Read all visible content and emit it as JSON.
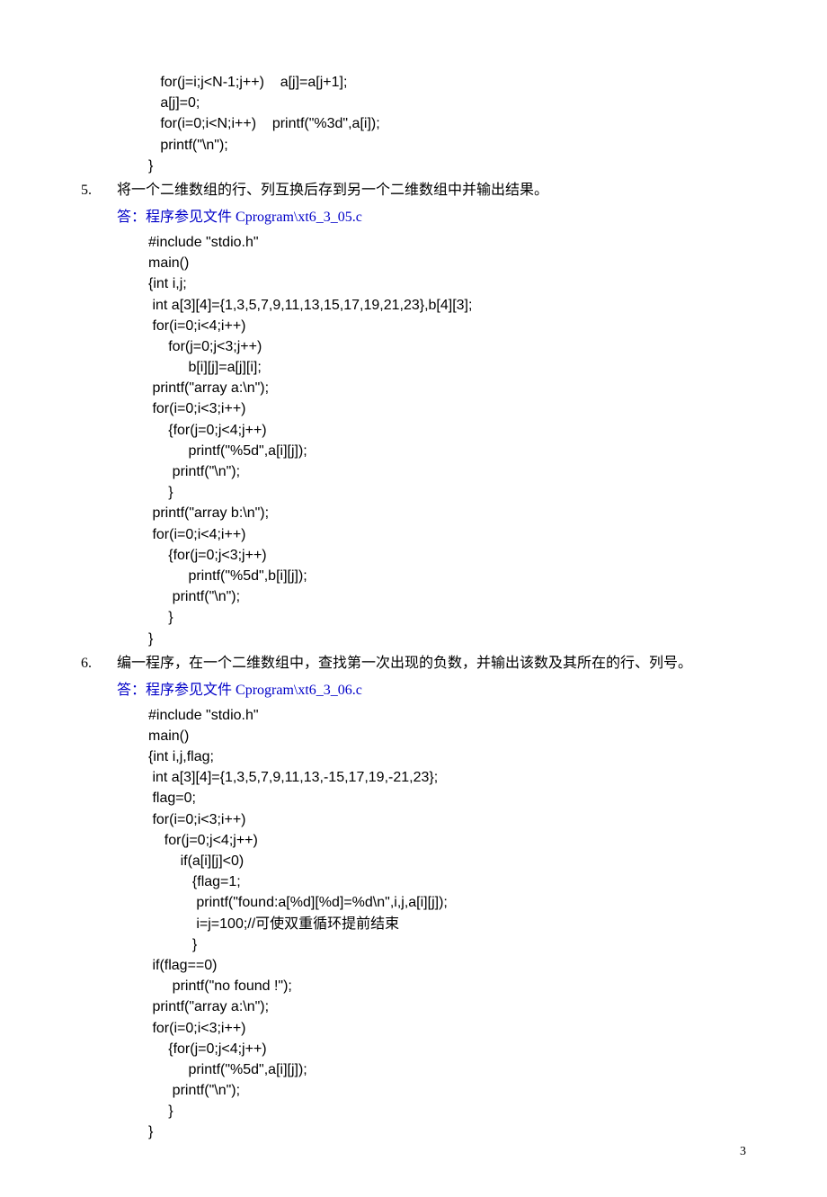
{
  "code_top": "   for(j=i;j<N-1;j++)    a[j]=a[j+1];\n   a[j]=0;\n   for(i=0;i<N;i++)    printf(\"%3d\",a[i]);\n   printf(\"\\n\");\n}",
  "problem5": {
    "num": "5.",
    "text": "将一个二维数组的行、列互换后存到另一个二维数组中并输出结果。",
    "answer_prefix": "答：程序参见文件 ",
    "answer_path": "Cprogram\\xt6_3_05.c",
    "code": "#include \"stdio.h\"\nmain()\n{int i,j;\n int a[3][4]={1,3,5,7,9,11,13,15,17,19,21,23},b[4][3];\n for(i=0;i<4;i++)\n     for(j=0;j<3;j++)\n          b[i][j]=a[j][i];\n printf(\"array a:\\n\");\n for(i=0;i<3;i++)\n     {for(j=0;j<4;j++)\n          printf(\"%5d\",a[i][j]);\n      printf(\"\\n\");\n     }\n printf(\"array b:\\n\");\n for(i=0;i<4;i++)\n     {for(j=0;j<3;j++)\n          printf(\"%5d\",b[i][j]);\n      printf(\"\\n\");\n     }\n}"
  },
  "problem6": {
    "num": "6.",
    "text": "编一程序，在一个二维数组中，查找第一次出现的负数，并输出该数及其所在的行、列号。",
    "answer_prefix": "答：程序参见文件 ",
    "answer_path": "Cprogram\\xt6_3_06.c",
    "code": "#include \"stdio.h\"\nmain()\n{int i,j,flag;\n int a[3][4]={1,3,5,7,9,11,13,-15,17,19,-21,23};\n flag=0;\n for(i=0;i<3;i++)\n    for(j=0;j<4;j++)\n        if(a[i][j]<0)\n           {flag=1;\n            printf(\"found:a[%d][%d]=%d\\n\",i,j,a[i][j]);\n            i=j=100;//可使双重循环提前结束\n           }\n if(flag==0)\n      printf(\"no found !\");\n printf(\"array a:\\n\");\n for(i=0;i<3;i++)\n     {for(j=0;j<4;j++)\n          printf(\"%5d\",a[i][j]);\n      printf(\"\\n\");\n     }\n}"
  },
  "page_number": "3"
}
